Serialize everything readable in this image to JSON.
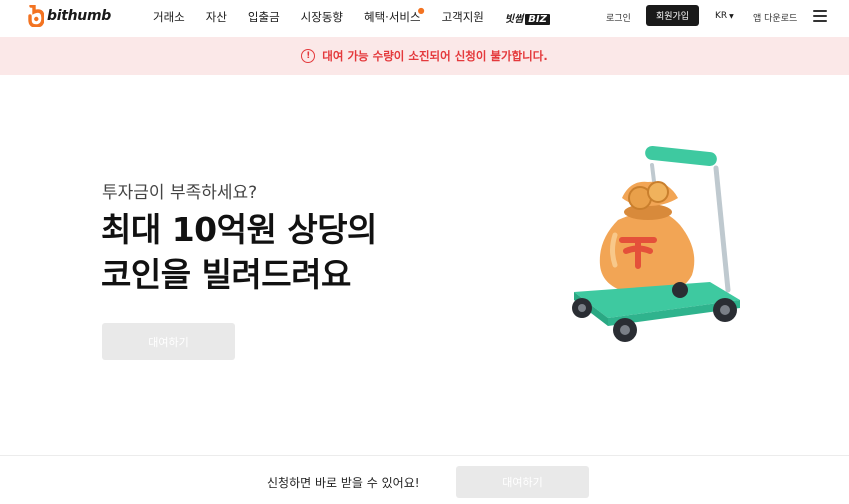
{
  "header": {
    "logo_text": "bithumb",
    "nav": [
      {
        "label": "거래소"
      },
      {
        "label": "자산"
      },
      {
        "label": "입출금"
      },
      {
        "label": "시장동향"
      },
      {
        "label": "혜택·서비스",
        "new_dot": true
      },
      {
        "label": "고객지원"
      }
    ],
    "biz": {
      "prefix": "빗썸",
      "box": "BIZ"
    },
    "login_label": "로그인",
    "signup_label": "회원가입",
    "language": "KR",
    "app_download_label": "앱 다운로드",
    "menu_icon": "hamburger-menu-icon"
  },
  "alert": {
    "icon": "exclamation-circle-icon",
    "text": "대여 가능 수량이 소진되어 신청이 불가합니다.",
    "color": "#e4393c",
    "background": "#fbe8e8"
  },
  "hero": {
    "subtitle": "투자금이 부족하세요?",
    "headline_line1": "최대 10억원 상당의",
    "headline_line2": "코인을 빌려드려요",
    "button_label": "대여하기",
    "button_disabled": true
  },
  "bottom_bar": {
    "text": "신청하면 바로 받을 수 있어요!",
    "button_label": "대여하기",
    "button_disabled": true
  },
  "colors": {
    "brand_orange": "#f37321",
    "cart_green": "#3ec9a0",
    "bag_orange": "#f2a555",
    "disabled_button": "#e9e9e9"
  }
}
